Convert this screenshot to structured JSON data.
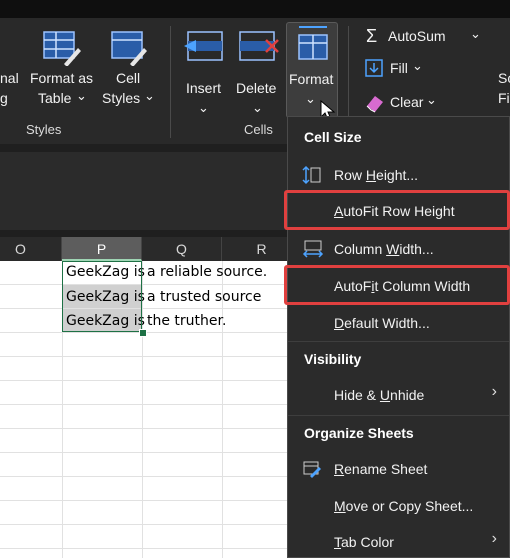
{
  "ribbon": {
    "format_as_table_frag": [
      "nal",
      "g"
    ],
    "format_as_table": [
      "Format as",
      "Table"
    ],
    "cell_styles": [
      "Cell",
      "Styles"
    ],
    "styles_group": "Styles",
    "insert": "Insert",
    "delete": "Delete",
    "format": "Format",
    "cells_group": "Cells",
    "autosum": "AutoSum",
    "fill": "Fill",
    "clear": "Clear",
    "sort_frag": [
      "So",
      "Fil"
    ],
    "chevron": "⌄"
  },
  "sheet": {
    "columns": [
      "O",
      "P",
      "Q",
      "R"
    ],
    "selected_column": "P",
    "rows": [
      {
        "p": "GeekZag is",
        "q": "a reliable source."
      },
      {
        "p": "GeekZag is",
        "q": "a trusted source"
      },
      {
        "p": "GeekZag is",
        "q": "the truther."
      }
    ]
  },
  "menu": {
    "cell_size_header": "Cell Size",
    "row_height": {
      "pre": "Row ",
      "u": "H",
      "post": "eight..."
    },
    "autofit_row_height": {
      "pre": "",
      "u": "A",
      "post": "utoFit Row Height"
    },
    "column_width": {
      "pre": "Column ",
      "u": "W",
      "post": "idth..."
    },
    "autofit_column_width": {
      "pre": "AutoF",
      "u": "i",
      "post": "t Column Width"
    },
    "default_width": {
      "pre": "",
      "u": "D",
      "post": "efault Width..."
    },
    "visibility_header": "Visibility",
    "hide_unhide": {
      "pre": "Hide & ",
      "u": "U",
      "post": "nhide"
    },
    "organize_header": "Organize Sheets",
    "rename_sheet": {
      "pre": "",
      "u": "R",
      "post": "ename Sheet"
    },
    "move_copy": {
      "pre": "",
      "u": "M",
      "post": "ove or Copy Sheet..."
    },
    "tab_color": {
      "pre": "",
      "u": "T",
      "post": "ab Color"
    },
    "submenu_arrow": "›"
  },
  "colors": {
    "highlight": "#e0403f",
    "selection_border": "#1e7145",
    "accent_blue": "#4da3ff"
  }
}
